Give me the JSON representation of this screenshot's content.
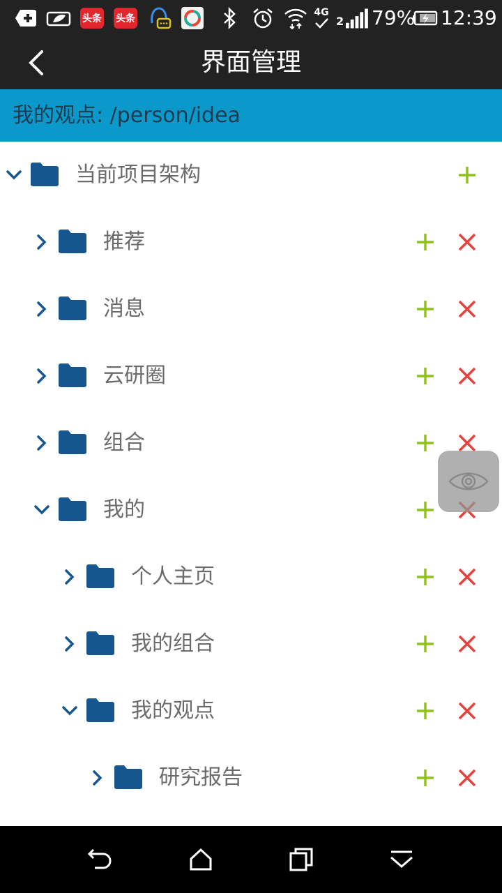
{
  "status_bar": {
    "icons": [
      "add-box-icon",
      "leaf-icon",
      "toutiao-app-icon",
      "toutiao-app-icon",
      "qq-icon",
      "app-icon",
      "bluetooth-icon",
      "alarm-icon",
      "wifi-icon",
      "4g-icon",
      "signal-icon",
      "battery-icon"
    ],
    "app_badge_1": "头条",
    "app_badge_2": "头条",
    "network": "4G",
    "signal_prefix": "2",
    "battery_percent": "79%",
    "time": "12:39"
  },
  "header": {
    "title": "界面管理",
    "back_icon": "back-arrow-icon"
  },
  "path_bar": {
    "text": "我的观点:  /person/idea"
  },
  "tree": {
    "root": {
      "label": "当前项目架构",
      "expanded": true
    },
    "items": [
      {
        "label": "推荐",
        "depth": 1,
        "expanded": false
      },
      {
        "label": "消息",
        "depth": 1,
        "expanded": false
      },
      {
        "label": "云研圈",
        "depth": 1,
        "expanded": false
      },
      {
        "label": "组合",
        "depth": 1,
        "expanded": false
      },
      {
        "label": "我的",
        "depth": 1,
        "expanded": true
      },
      {
        "label": "个人主页",
        "depth": 2,
        "expanded": false
      },
      {
        "label": "我的组合",
        "depth": 2,
        "expanded": false
      },
      {
        "label": "我的观点",
        "depth": 2,
        "expanded": true
      },
      {
        "label": "研究报告",
        "depth": 3,
        "expanded": false
      }
    ]
  },
  "floating": {
    "icon": "eye-icon"
  },
  "nav_bar": {
    "icons": [
      "back-icon",
      "home-icon",
      "recents-icon",
      "menu-down-icon"
    ]
  },
  "colors": {
    "bar_dark": "#222222",
    "path_bar": "#0b99cc",
    "folder": "#15568e",
    "add": "#8cc418",
    "delete": "#e8413b",
    "label": "#6b6b6b"
  }
}
